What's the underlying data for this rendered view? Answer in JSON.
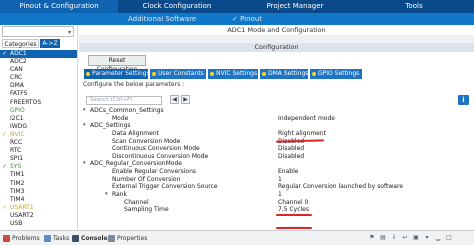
{
  "top_tabs": [
    {
      "label": "Pinout & Configuration",
      "active": true
    },
    {
      "label": "Clock Configuration",
      "active": false
    },
    {
      "label": "Project Manager",
      "active": false
    },
    {
      "label": "Tools",
      "active": false
    }
  ],
  "sub_bar": {
    "additional_software": "Additional Software",
    "pinout": "✓ Pinout"
  },
  "left_panel": {
    "search_placeholder": "",
    "categories_tab": "Categories",
    "az_tab": "A->Z",
    "peripherals": [
      {
        "label": "ADC1",
        "state": "selected",
        "check": "✓"
      },
      {
        "label": "ADC2",
        "state": "normal",
        "check": ""
      },
      {
        "label": "CAN",
        "state": "normal",
        "check": ""
      },
      {
        "label": "CRC",
        "state": "normal",
        "check": ""
      },
      {
        "label": "DMA",
        "state": "normal",
        "check": ""
      },
      {
        "label": "FATFS",
        "state": "normal",
        "check": ""
      },
      {
        "label": "FREERTOS",
        "state": "normal",
        "check": ""
      },
      {
        "label": "GPIO",
        "state": "green",
        "check": ""
      },
      {
        "label": "I2C1",
        "state": "normal",
        "check": ""
      },
      {
        "label": "IWDG",
        "state": "normal",
        "check": ""
      },
      {
        "label": "NVIC",
        "state": "yellow",
        "check": "✓"
      },
      {
        "label": "RCC",
        "state": "normal",
        "check": ""
      },
      {
        "label": "RTC",
        "state": "normal",
        "check": ""
      },
      {
        "label": "SPI1",
        "state": "normal",
        "check": ""
      },
      {
        "label": "SYS",
        "state": "green",
        "check": "✓"
      },
      {
        "label": "TIM1",
        "state": "normal",
        "check": ""
      },
      {
        "label": "TIM2",
        "state": "normal",
        "check": ""
      },
      {
        "label": "TIM3",
        "state": "normal",
        "check": ""
      },
      {
        "label": "TIM4",
        "state": "normal",
        "check": ""
      },
      {
        "label": "USART1",
        "state": "yellow",
        "check": "✓"
      },
      {
        "label": "USART2",
        "state": "normal",
        "check": ""
      },
      {
        "label": "USB",
        "state": "normal",
        "check": ""
      }
    ]
  },
  "main": {
    "title": "ADC1 Mode and Configuration",
    "configuration_bar": "Configuration",
    "reset_button": "Reset Configuration",
    "setting_tabs": [
      {
        "label": "Parameter Settings",
        "active": true
      },
      {
        "label": "User Constants",
        "active": false
      },
      {
        "label": "NVIC Settings",
        "active": false
      },
      {
        "label": "DMA Settings",
        "active": false
      },
      {
        "label": "GPIO Settings",
        "active": false
      }
    ],
    "configure_label": "Configure the below parameters :",
    "search_placeholder": "Search (Ctrl+F)",
    "tree": [
      {
        "name": "ADCs_Common_Settings",
        "value": "",
        "level": 0,
        "expander": "▾"
      },
      {
        "name": "Mode",
        "value": "Independent mode",
        "level": 1,
        "expander": ""
      },
      {
        "name": "ADC_Settings",
        "value": "",
        "level": 0,
        "expander": "▾"
      },
      {
        "name": "Data Alignment",
        "value": "Right alignment",
        "level": 1,
        "expander": ""
      },
      {
        "name": "Scan Conversion Mode",
        "value": "Disabled",
        "level": 1,
        "expander": ""
      },
      {
        "name": "Continuous Conversion Mode",
        "value": "Disabled",
        "level": 1,
        "expander": ""
      },
      {
        "name": "Discontinuous Conversion Mode",
        "value": "Disabled",
        "level": 1,
        "expander": ""
      },
      {
        "name": "ADC_Regular_ConversionMode",
        "value": "",
        "level": 0,
        "expander": "▾"
      },
      {
        "name": "Enable Regular Conversions",
        "value": "Enable",
        "level": 1,
        "expander": ""
      },
      {
        "name": "Number Of Conversion",
        "value": "1",
        "level": 1,
        "expander": ""
      },
      {
        "name": "External Trigger Conversion Source",
        "value": "Regular Conversion launched by software",
        "level": 1,
        "expander": ""
      },
      {
        "name": "Rank",
        "value": "1",
        "level": 1,
        "expander": "▾"
      },
      {
        "name": "Channel",
        "value": "Channel 0",
        "level": 2,
        "expander": ""
      },
      {
        "name": "Sampling Time",
        "value": "7.5 Cycles",
        "level": 2,
        "expander": ""
      }
    ]
  },
  "bottom_tabs": [
    {
      "label": "Problems",
      "active": false,
      "icon_color": "#c94a3a"
    },
    {
      "label": "Tasks",
      "active": false,
      "icon_color": "#5b8bc4"
    },
    {
      "label": "Console",
      "active": true,
      "icon_color": "#3a4f66"
    },
    {
      "label": "Properties",
      "active": false,
      "icon_color": "#7b8e9f"
    }
  ],
  "colors": {
    "top_bar": "#0a4a8a",
    "active_tab": "#0f63b0",
    "accent_blue": "#1e74c4",
    "annotation_red": "#d8262b"
  }
}
